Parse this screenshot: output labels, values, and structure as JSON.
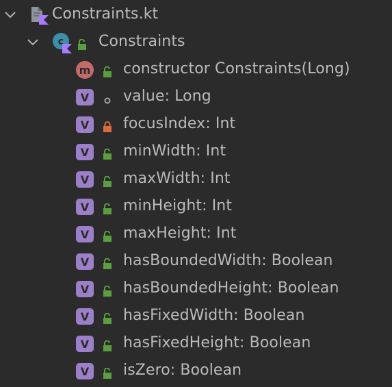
{
  "file": {
    "name": "Constraints.kt"
  },
  "class": {
    "name": "Constraints"
  },
  "members": [
    {
      "badge": "m",
      "visibility": "public",
      "label": "constructor Constraints(Long)"
    },
    {
      "badge": "V",
      "visibility": "internal",
      "label": "value: Long"
    },
    {
      "badge": "V",
      "visibility": "private",
      "label": "focusIndex: Int"
    },
    {
      "badge": "V",
      "visibility": "public",
      "label": "minWidth: Int"
    },
    {
      "badge": "V",
      "visibility": "public",
      "label": "maxWidth: Int"
    },
    {
      "badge": "V",
      "visibility": "public",
      "label": "minHeight: Int"
    },
    {
      "badge": "V",
      "visibility": "public",
      "label": "maxHeight: Int"
    },
    {
      "badge": "V",
      "visibility": "public",
      "label": "hasBoundedWidth: Boolean"
    },
    {
      "badge": "V",
      "visibility": "public",
      "label": "hasBoundedHeight: Boolean"
    },
    {
      "badge": "V",
      "visibility": "public",
      "label": "hasFixedWidth: Boolean"
    },
    {
      "badge": "V",
      "visibility": "public",
      "label": "hasFixedHeight: Boolean"
    },
    {
      "badge": "V",
      "visibility": "public",
      "label": "isZero: Boolean"
    }
  ],
  "icons": {
    "file": "kotlin-file-icon",
    "class": "kotlin-class-icon",
    "expand": "chevron-down-icon",
    "public": "unlocked-padlock-icon",
    "private": "locked-padlock-icon",
    "internal": "circle-dot-icon"
  },
  "colors": {
    "background": "#2b2b2b",
    "text": "#bbbbbb",
    "property_badge": "#9c7fc9",
    "method_badge": "#c36b6b",
    "public": "#5a9e3f",
    "private": "#d96c3a"
  }
}
